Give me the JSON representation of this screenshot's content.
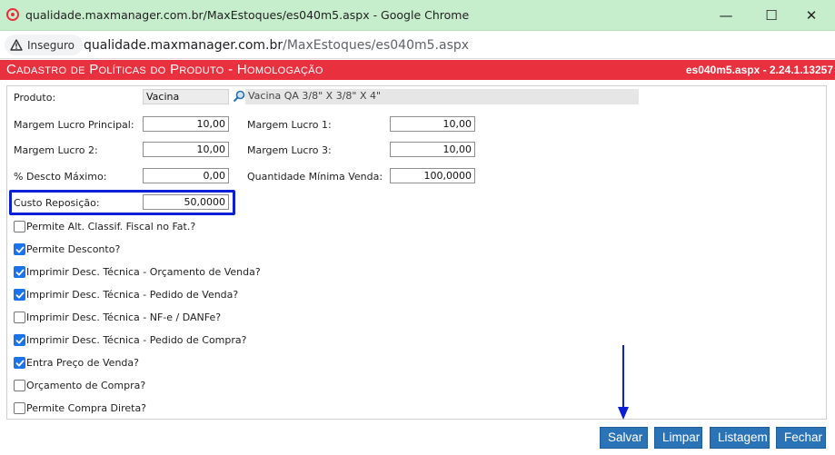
{
  "window": {
    "title": "qualidade.maxmanager.com.br/MaxEstoques/es040m5.aspx - Google Chrome",
    "minimize_glyph": "—",
    "maximize_glyph": "☐",
    "close_glyph": "✕"
  },
  "addressbar": {
    "security_label": "Inseguro",
    "url_host": "qualidade.maxmanager.com.br",
    "url_path": "/MaxEstoques/es040m5.aspx"
  },
  "banner": {
    "title": "Cadastro de Políticas do Produto  - Homologação",
    "code": "es040m5.aspx - 2.24.1.13257",
    "color": "#e8303f"
  },
  "form": {
    "produto_label": "Produto:",
    "produto_value": "Vacina",
    "produto_desc": "Vacina QA 3/8\" X 3/8\" X 4\"",
    "margem_principal_label": "Margem Lucro Principal:",
    "margem_principal_value": "10,00",
    "margem1_label": "Margem Lucro 1:",
    "margem1_value": "10,00",
    "margem2_label": "Margem Lucro 2:",
    "margem2_value": "10,00",
    "margem3_label": "Margem Lucro 3:",
    "margem3_value": "10,00",
    "desconto_label": "% Descto Máximo:",
    "desconto_value": "0,00",
    "qtd_min_label": "Quantidade Mínima Venda:",
    "qtd_min_value": "100,0000",
    "custo_label": "Custo Reposição:",
    "custo_value": "50,0000"
  },
  "checkboxes": [
    {
      "label": "Permite Alt. Classif. Fiscal no Fat.?",
      "checked": false
    },
    {
      "label": "Permite Desconto?",
      "checked": true
    },
    {
      "label": "Imprimir Desc. Técnica - Orçamento de Venda?",
      "checked": true
    },
    {
      "label": "Imprimir Desc. Técnica - Pedido de Venda?",
      "checked": true
    },
    {
      "label": "Imprimir Desc. Técnica - NF-e / DANFe?",
      "checked": false
    },
    {
      "label": "Imprimir Desc. Técnica - Pedido de Compra?",
      "checked": true
    },
    {
      "label": "Entra Preço de Venda?",
      "checked": true
    },
    {
      "label": "Orçamento de Compra?",
      "checked": false
    },
    {
      "label": "Permite Compra Direta?",
      "checked": false
    }
  ],
  "buttons": {
    "salvar": "Salvar",
    "limpar": "Limpar",
    "listagem": "Listagem",
    "fechar": "Fechar",
    "color": "#2a73b6"
  },
  "annotation_color": "#0b1fd6"
}
